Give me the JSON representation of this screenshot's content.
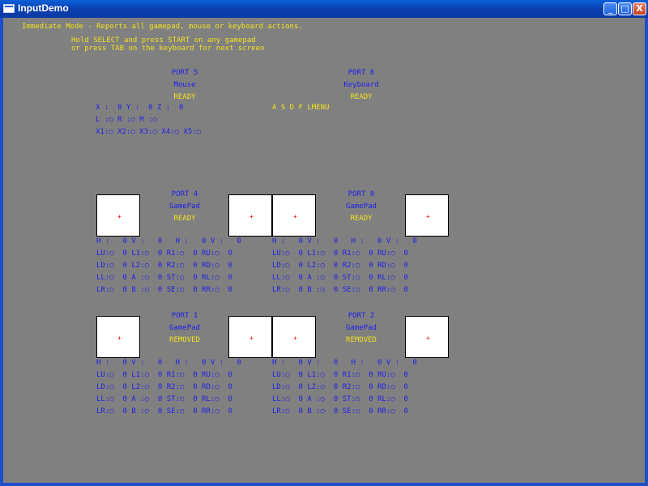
{
  "window": {
    "title": "InputDemo",
    "minimize_label": "_",
    "maximize_label": "□",
    "close_label": "X"
  },
  "header": {
    "line1": "Immediate Mode - Reports all gamepad, mouse or keyboard actions.",
    "line2": "Hold SELECT and press START on any gamepad",
    "line3": "or press TAB on the keyboard for next screen"
  },
  "mouse": {
    "port": "PORT 5",
    "type": "Mouse",
    "status": "READY",
    "row1": "X :  0 Y :  0 Z :  0",
    "row2": "L :○ R :○ M :○",
    "row3": "X1:○ X2:○ X3:○ X4:○ X5:○"
  },
  "keyboard": {
    "port": "PORT 6",
    "type": "Keyboard",
    "status": "READY",
    "keys": "A S D F LMENU"
  },
  "pads": {
    "p4": {
      "port": "PORT 4",
      "type": "GamePad",
      "status": "READY"
    },
    "p0": {
      "port": "PORT 0",
      "type": "GamePad",
      "status": "READY"
    },
    "p1": {
      "port": "PORT 1",
      "type": "GamePad",
      "status": "REMOVED"
    },
    "p2": {
      "port": "PORT 2",
      "type": "GamePad",
      "status": "REMOVED"
    }
  },
  "grid": {
    "hv_row": "H :   0 V :   0   H :   0 V :   0",
    "r1": "LU:○  0 L1:○  0 R1:○  0 RU:○  0",
    "r2": "LD:○  0 L2:○  0 R2:○  0 RD:○  0",
    "r3": "LL:○  0 A :○  0 ST:○  0 RL:○  0",
    "r4": "LR:○  0 B :○  0 SE:○  0 RR:○  0"
  }
}
